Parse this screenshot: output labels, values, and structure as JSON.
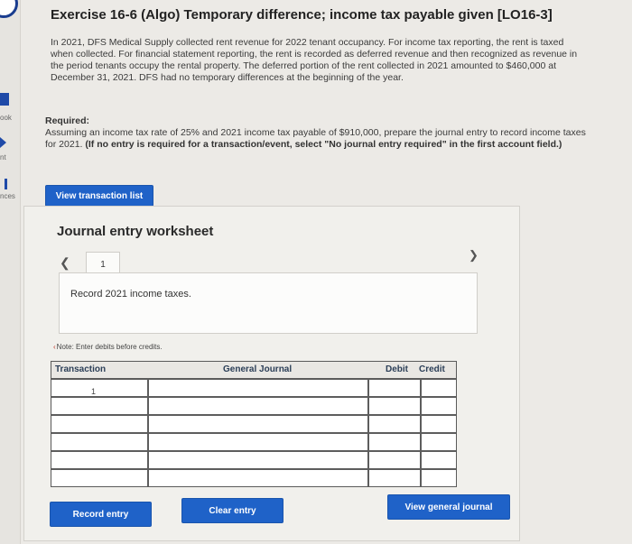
{
  "sidebar": {
    "items": [
      {
        "label": "ook"
      },
      {
        "label": "nt"
      },
      {
        "label": "nces"
      }
    ]
  },
  "header": {
    "title": "Exercise 16-6 (Algo) Temporary difference; income tax payable given [LO16-3]"
  },
  "problem": {
    "text": "In 2021, DFS Medical Supply collected rent revenue for 2022 tenant occupancy. For income tax reporting, the rent is taxed when collected. For financial statement reporting, the rent is recorded as deferred revenue and then recognized as revenue in the period tenants occupy the rental property. The deferred portion of the rent collected in 2021 amounted to $460,000 at December 31, 2021. DFS had no temporary differences at the beginning of the year.",
    "required_heading": "Required:",
    "required_text": "Assuming an income tax rate of 25% and 2021 income tax payable of $910,000, prepare the journal entry to record income taxes for 2021.",
    "required_note": "(If no entry is required for a transaction/event, select \"No journal entry required\" in the first account field.)"
  },
  "buttons": {
    "view_transactions": "View transaction list",
    "record_entry": "Record entry",
    "clear_entry": "Clear entry",
    "view_general_journal": "View general journal"
  },
  "worksheet": {
    "title": "Journal entry worksheet",
    "prev_icon": "chevron-left-icon",
    "next_icon": "chevron-right-icon",
    "current_tab": "1",
    "description": "Record 2021 income taxes.",
    "note": "Note: Enter debits before credits.",
    "table": {
      "columns": [
        "Transaction",
        "General Journal",
        "Debit",
        "Credit"
      ],
      "rows": [
        {
          "transaction": "1",
          "account": "",
          "debit": "",
          "credit": ""
        },
        {
          "transaction": "",
          "account": "",
          "debit": "",
          "credit": ""
        },
        {
          "transaction": "",
          "account": "",
          "debit": "",
          "credit": ""
        },
        {
          "transaction": "",
          "account": "",
          "debit": "",
          "credit": ""
        },
        {
          "transaction": "",
          "account": "",
          "debit": "",
          "credit": ""
        },
        {
          "transaction": "",
          "account": "",
          "debit": "",
          "credit": ""
        }
      ]
    }
  },
  "colors": {
    "accent": "#1f62c8",
    "background": "#eceae6",
    "panel": "#f1f0ec"
  }
}
